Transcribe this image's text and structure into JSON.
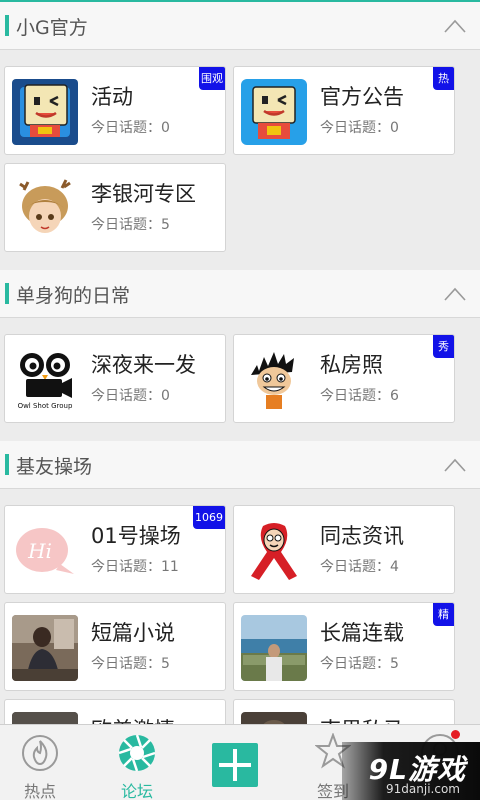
{
  "colors": {
    "accent": "#29b9a0",
    "badge": "#1212e8",
    "notify": "#e51c23"
  },
  "sections": [
    {
      "title": "小G官方",
      "cards": [
        {
          "title": "活动",
          "topics": "今日话题：0",
          "badge": "围观",
          "image": "blue-square-mascot-avatar"
        },
        {
          "title": "官方公告",
          "topics": "今日话题：0",
          "badge": "热",
          "image": "blue-square-mascot-avatar"
        },
        {
          "title": "李银河专区",
          "topics": "今日话题：5",
          "image": "antler-girl-avatar"
        }
      ]
    },
    {
      "title": "单身狗的日常",
      "cards": [
        {
          "title": "深夜来一发",
          "topics": "今日话题：0",
          "image": "owl-shot-group-logo",
          "image_text": "Owl Shot Group"
        },
        {
          "title": "私房照",
          "topics": "今日话题：6",
          "badge": "秀",
          "image": "cartoon-spiky-man-avatar"
        }
      ]
    },
    {
      "title": "基友操场",
      "cards": [
        {
          "title": "01号操场",
          "topics": "今日话题：11",
          "badge": "1069",
          "image": "hi-speech-bubble-avatar",
          "image_text": "Hi"
        },
        {
          "title": "同志资讯",
          "topics": "今日话题：4",
          "image": "red-ribbon-face-avatar"
        },
        {
          "title": "短篇小说",
          "topics": "今日话题：5",
          "image": "man-photo-thumbnail"
        },
        {
          "title": "长篇连载",
          "topics": "今日话题：5",
          "badge": "精",
          "image": "sea-photo-thumbnail"
        },
        {
          "title": "欧美激情",
          "image": "photo-thumbnail"
        },
        {
          "title": "南男私马",
          "image": "photo-thumbnail"
        }
      ]
    }
  ],
  "bottom_nav": [
    {
      "label": "热点",
      "icon": "flame-icon"
    },
    {
      "label": "论坛",
      "icon": "aperture-icon",
      "active": true
    },
    {
      "label": "",
      "icon": "plus-icon"
    },
    {
      "label": "签到",
      "icon": "star-icon"
    },
    {
      "label": "",
      "icon": "profile-icon"
    }
  ],
  "watermark": {
    "brand": "9L游戏",
    "url": "91danji.com"
  }
}
